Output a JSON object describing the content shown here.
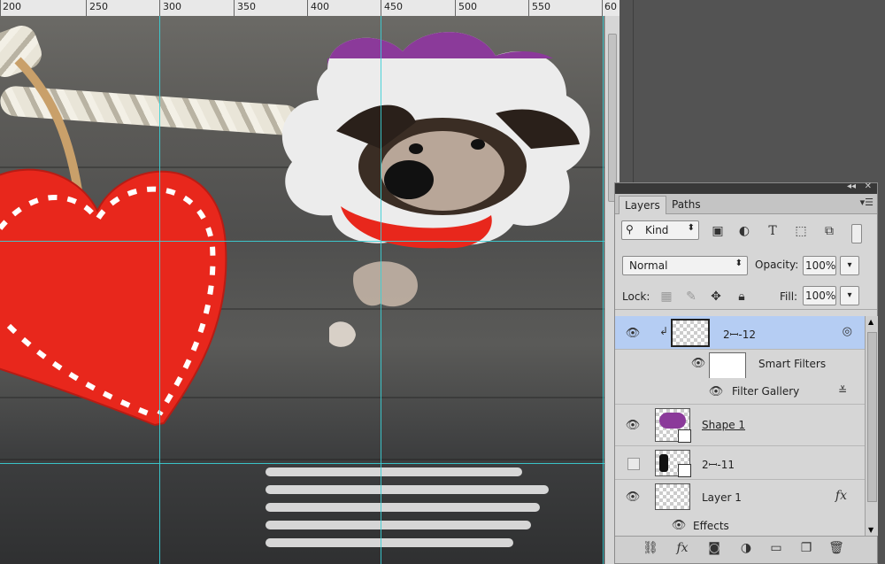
{
  "ruler": {
    "labels": [
      "200",
      "250",
      "300",
      "350",
      "400",
      "450",
      "500",
      "550",
      "60"
    ]
  },
  "layers_panel": {
    "tabs": [
      "Layers",
      "Paths"
    ],
    "filter_kind": "Kind",
    "blend_mode": "Normal",
    "opacity_label": "Opacity:",
    "opacity_value": "100%",
    "lock_label": "Lock:",
    "fill_label": "Fill:",
    "fill_value": "100%",
    "layers": [
      {
        "name": "2ꟷ-12",
        "visible": true,
        "selected": true
      },
      {
        "name": "Smart Filters"
      },
      {
        "name": "Filter Gallery"
      },
      {
        "name": "Shape 1",
        "visible": true
      },
      {
        "name": "2ꟷ-11",
        "visible": false
      },
      {
        "name": "Layer 1",
        "visible": true,
        "fx": "fx"
      },
      {
        "name": "Effects"
      }
    ]
  },
  "icons": {
    "panel_collapse": "double-chevron-left-icon",
    "panel_close": "close-icon",
    "panel_menu": "panel-menu-icon",
    "search": "search-icon",
    "visibility": "eye-icon",
    "link": "link-icon",
    "fx": "fx-icon",
    "mask": "mask-icon",
    "adjustment": "adjustment-icon",
    "group": "folder-icon",
    "new_layer": "new-layer-icon",
    "trash": "trash-icon"
  },
  "colors": {
    "guide": "#3ad0d6",
    "selection": "#b5cdf3",
    "cloud_purple": "#8b3a9a",
    "heart_red": "#e8271c"
  }
}
